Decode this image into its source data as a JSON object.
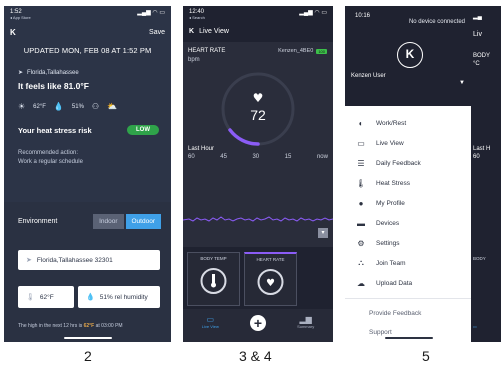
{
  "screen2": {
    "time": "1:52",
    "carrier": "◂ App Store",
    "save_label": "Save",
    "updated": "UPDATED MON, FEB 08 AT 1:52 PM",
    "location": "Florida,Tallahassee",
    "feels_like": "It feels like 81.0°F",
    "temp": "62°F",
    "humidity": "51%",
    "risk_label": "Your heat stress risk",
    "risk_badge": "LOW",
    "rec_line1": "Recommended action:",
    "rec_line2": "Work a regular schedule",
    "env_label": "Environment",
    "indoor": "Indoor",
    "outdoor": "Outdoor",
    "location_field": "Florida,Tallahassee 32301",
    "temp_field": "62°F",
    "humidity_field": "51% rel humidity",
    "footer_prefix": "The high in the next 12 hrs is",
    "footer_high": "62°F",
    "footer_suffix": "at 03:00 PM"
  },
  "screen3": {
    "time": "12:40",
    "carrier": "◂ Search",
    "title": "Live View",
    "hr_title": "HEART RATE",
    "bpm": "bpm",
    "device": "Kenzen_4BE0",
    "battery": "100",
    "value": "72",
    "last_hour": "Last Hour",
    "ticks": [
      "60",
      "45",
      "30",
      "15",
      "now"
    ],
    "card1": "BODY TEMP",
    "card2": "HEART RATE",
    "tab1": "Live View",
    "tab3": "Summary"
  },
  "screen5": {
    "time": "10:16",
    "no_device": "No device connected",
    "user": "Kenzen User",
    "menu": [
      {
        "label": "Work/Rest",
        "icon": "work-rest-icon"
      },
      {
        "label": "Live View",
        "icon": "live-view-icon"
      },
      {
        "label": "Daily Feedback",
        "icon": "list-icon"
      },
      {
        "label": "Heat Stress",
        "icon": "thermometer-icon"
      },
      {
        "label": "My Profile",
        "icon": "person-icon"
      },
      {
        "label": "Devices",
        "icon": "device-icon"
      },
      {
        "label": "Settings",
        "icon": "gear-icon"
      },
      {
        "label": "Join Team",
        "icon": "team-icon"
      },
      {
        "label": "Upload Data",
        "icon": "cloud-upload-icon"
      }
    ],
    "provide_feedback": "Provide Feedback",
    "support": "Support",
    "peek_body": "BODY",
    "peek_c": "°C",
    "peek_k": "Liv",
    "peek_last": "Last H",
    "peek_60": "60",
    "peek_body2": "BODY"
  },
  "captions": {
    "c1": "2",
    "c2": "3 & 4",
    "c3": "5"
  },
  "colors": {
    "screen2_bg": "#2c3447",
    "dark_bg": "#1f2230",
    "accent_blue": "#3fa0e8",
    "risk_green": "#2fa34a",
    "gauge_purple": "#8b5cf6",
    "high_orange": "#e0a44a"
  }
}
